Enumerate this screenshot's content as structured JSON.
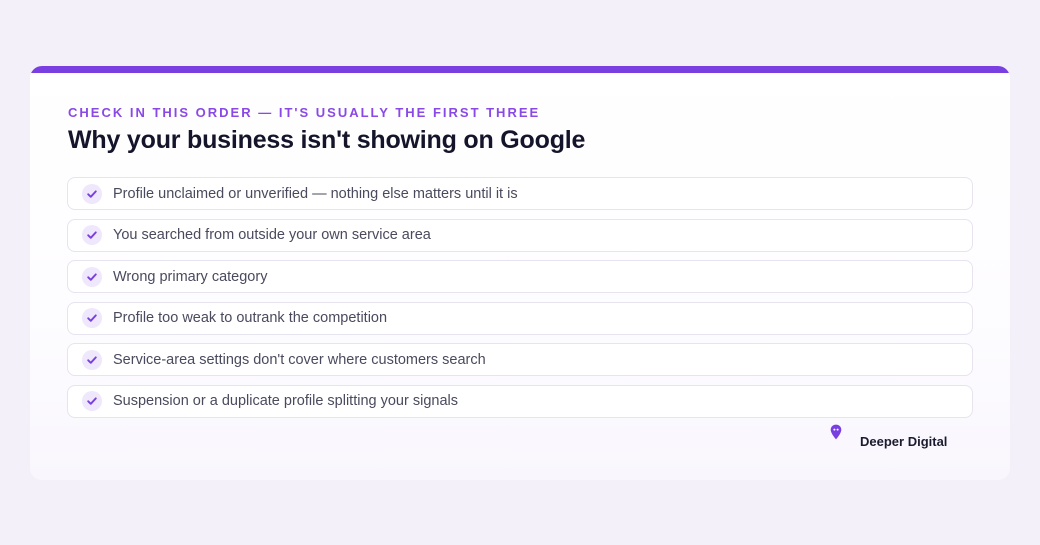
{
  "card": {
    "eyebrow": "CHECK IN THIS ORDER — IT'S USUALLY THE FIRST THREE",
    "title": "Why your business isn't showing on Google",
    "items": [
      {
        "label": "Profile unclaimed or unverified — nothing else matters until it is"
      },
      {
        "label": "You searched from outside your own service area"
      },
      {
        "label": "Wrong primary category"
      },
      {
        "label": "Profile too weak to outrank the competition"
      },
      {
        "label": "Service-area settings don't cover where customers search"
      },
      {
        "label": "Suspension or a duplicate profile splitting your signals"
      }
    ],
    "check_icon": "check-icon"
  },
  "brand": {
    "name": "Deeper Digital",
    "logo_icon": "map-pin-icon"
  },
  "colors": {
    "page_background": "#f3f0fa",
    "accent": "#7a3fe0",
    "eyebrow": "#8a49e6",
    "title": "#14142b",
    "item_text": "#4a4a5e",
    "check_background": "#efe7fc"
  }
}
